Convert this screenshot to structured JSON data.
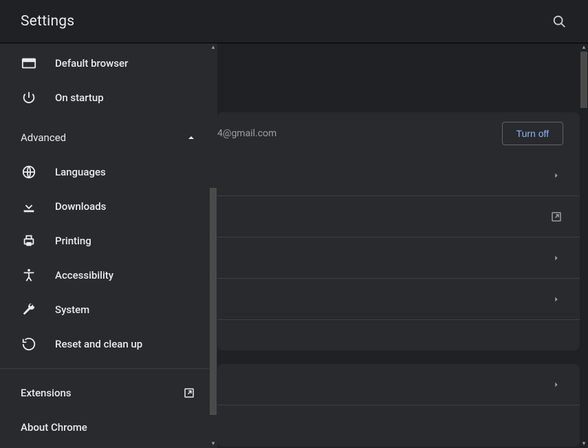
{
  "header": {
    "title": "Settings"
  },
  "sidebar": {
    "items_top": [
      {
        "id": "default-browser",
        "label": "Default browser",
        "icon": "browser"
      },
      {
        "id": "on-startup",
        "label": "On startup",
        "icon": "power"
      }
    ],
    "advanced_label": "Advanced",
    "advanced_expanded": true,
    "items_advanced": [
      {
        "id": "languages",
        "label": "Languages",
        "icon": "globe"
      },
      {
        "id": "downloads",
        "label": "Downloads",
        "icon": "download"
      },
      {
        "id": "printing",
        "label": "Printing",
        "icon": "printer"
      },
      {
        "id": "accessibility",
        "label": "Accessibility",
        "icon": "accessibility"
      },
      {
        "id": "system",
        "label": "System",
        "icon": "wrench"
      },
      {
        "id": "reset",
        "label": "Reset and clean up",
        "icon": "restore"
      }
    ],
    "bottom": {
      "extensions_label": "Extensions",
      "about_label": "About Chrome"
    }
  },
  "main": {
    "sync": {
      "email_suffix": "4@gmail.com",
      "turnoff_label": "Turn off"
    }
  }
}
